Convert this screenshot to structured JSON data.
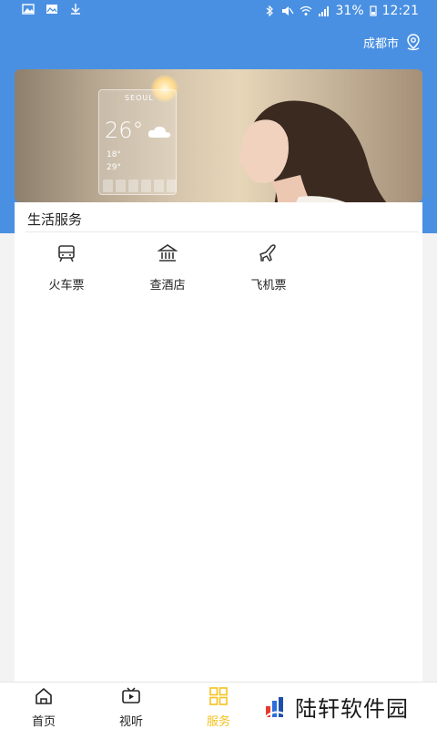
{
  "status_bar": {
    "battery": "31%",
    "time": "12:21"
  },
  "header": {
    "city": "成都市"
  },
  "banner": {
    "weather_city": "SEOUL",
    "weather_temp": "26°",
    "weather_low1": "18°",
    "weather_low2": "29°"
  },
  "section": {
    "title": "生活服务"
  },
  "services": [
    {
      "label": "火车票",
      "icon": "train-icon"
    },
    {
      "label": "查酒店",
      "icon": "hotel-icon"
    },
    {
      "label": "飞机票",
      "icon": "airplane-icon"
    }
  ],
  "tabs": [
    {
      "label": "首页",
      "icon": "home-icon",
      "active": false
    },
    {
      "label": "视听",
      "icon": "video-icon",
      "active": false
    },
    {
      "label": "服务",
      "icon": "grid-icon",
      "active": true
    }
  ],
  "watermark": {
    "text": "陆轩软件园"
  },
  "colors": {
    "header_blue": "#4a90e2",
    "active_tab": "#f4c21f"
  }
}
